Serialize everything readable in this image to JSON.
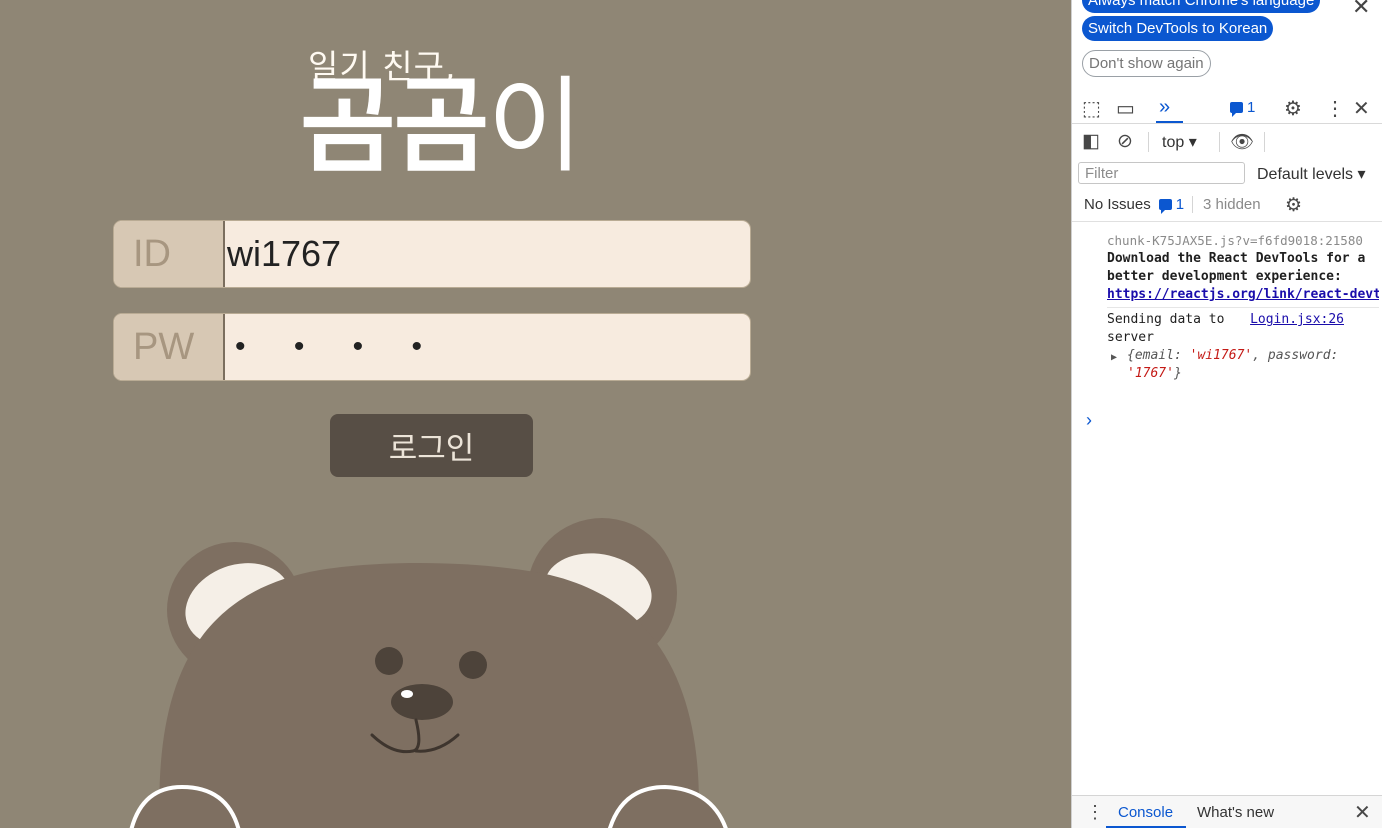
{
  "app": {
    "subtitle": "일기 친구,",
    "title_bold": "곰곰",
    "title_light": "이",
    "id_label": "ID",
    "id_value": "wi1767",
    "pw_label": "PW",
    "pw_value": "• • • •",
    "login_button": "로그인",
    "colors": {
      "background": "#8f8675",
      "button": "#574e45",
      "input": "#f7ebdf",
      "label_bg": "#d7c8b4"
    }
  },
  "devtools": {
    "infobar": {
      "top_button": "Always match Chrome's language",
      "switch_button": "Switch DevTools to Korean",
      "dont_show": "Don't show again"
    },
    "toolbar": {
      "message_count": "1"
    },
    "console_toolbar": {
      "context": "top",
      "filter_placeholder": "Filter",
      "levels": "Default levels ▾"
    },
    "issues": {
      "label": "No Issues",
      "count": "1",
      "hidden": "3 hidden"
    },
    "messages": [
      {
        "source": "chunk-K75JAX5E.js?v=f6fd9018:21580",
        "text": "Download the React DevTools for a better development experience: ",
        "link": "https://reactjs.org/link/react-devtools"
      },
      {
        "text": "Sending data to server",
        "source": "Login.jsx:26",
        "obj_email_key": "email: ",
        "obj_email_val": "'wi1767'",
        "obj_pw_key": ", password: ",
        "obj_pw_val": "'1767'"
      }
    ],
    "drawer": {
      "tab_console": "Console",
      "tab_whatsnew": "What's new"
    }
  }
}
